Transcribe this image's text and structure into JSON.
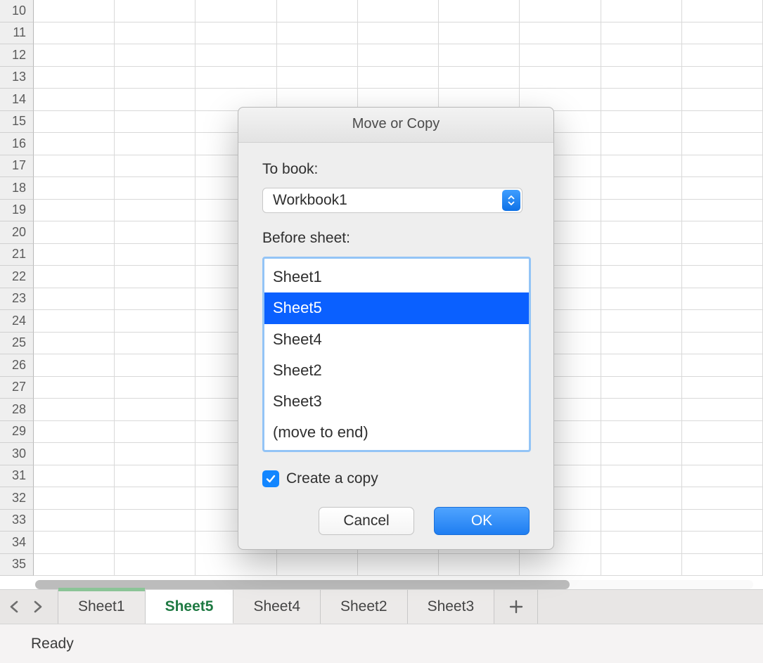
{
  "rows_start": 10,
  "rows_end": 35,
  "dialog": {
    "title": "Move or Copy",
    "to_book_label": "To book:",
    "to_book_value": "Workbook1",
    "before_sheet_label": "Before sheet:",
    "sheets": [
      "Sheet1",
      "Sheet5",
      "Sheet4",
      "Sheet2",
      "Sheet3",
      "(move to end)"
    ],
    "selected_index": 1,
    "create_copy_label": "Create a copy",
    "create_copy_checked": true,
    "cancel_label": "Cancel",
    "ok_label": "OK"
  },
  "tabs": {
    "items": [
      "Sheet1",
      "Sheet5",
      "Sheet4",
      "Sheet2",
      "Sheet3"
    ],
    "active_index": 1
  },
  "status": "Ready"
}
